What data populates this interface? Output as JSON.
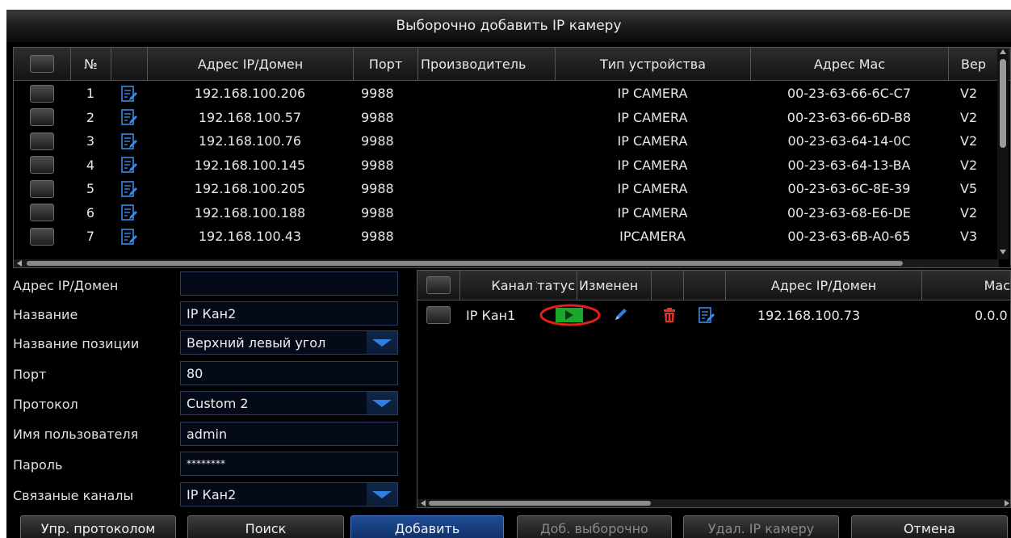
{
  "window": {
    "title": "Выборочно добавить IP камеру"
  },
  "colors": {
    "accent": "#2e7fe0",
    "primary_button": "#1f4d96",
    "status_ok": "#1aa82a",
    "delete_red": "#e0322a",
    "highlight_circle": "#e0201a"
  },
  "camera_table": {
    "headers": {
      "no": "№",
      "ip": "Адрес IP/Домен",
      "port": "Порт",
      "manufacturer": "Производитель",
      "device_type": "Тип устройства",
      "mac": "Адрес Mac",
      "version": "Вер"
    },
    "rows": [
      {
        "no": "1",
        "ip": "192.168.100.206",
        "port": "9988",
        "manufacturer": "",
        "device_type": "IP CAMERA",
        "mac": "00-23-63-66-6C-C7",
        "version": "V2"
      },
      {
        "no": "2",
        "ip": "192.168.100.57",
        "port": "9988",
        "manufacturer": "",
        "device_type": "IP CAMERA",
        "mac": "00-23-63-66-6D-B8",
        "version": "V2"
      },
      {
        "no": "3",
        "ip": "192.168.100.76",
        "port": "9988",
        "manufacturer": "",
        "device_type": "IP CAMERA",
        "mac": "00-23-63-64-14-0C",
        "version": "V2"
      },
      {
        "no": "4",
        "ip": "192.168.100.145",
        "port": "9988",
        "manufacturer": "",
        "device_type": "IP CAMERA",
        "mac": "00-23-63-64-13-BA",
        "version": "V2"
      },
      {
        "no": "5",
        "ip": "192.168.100.205",
        "port": "9988",
        "manufacturer": "",
        "device_type": "IP CAMERA",
        "mac": "00-23-63-6C-8E-39",
        "version": "V5"
      },
      {
        "no": "6",
        "ip": "192.168.100.188",
        "port": "9988",
        "manufacturer": "",
        "device_type": "IP CAMERA",
        "mac": "00-23-63-68-E6-DE",
        "version": "V2"
      },
      {
        "no": "7",
        "ip": "192.168.100.43",
        "port": "9988",
        "manufacturer": "",
        "device_type": "IPCAMERA",
        "mac": "00-23-63-6B-A0-65",
        "version": "V3"
      }
    ]
  },
  "form": {
    "ip_label": "Адрес IP/Домен",
    "ip_value": "",
    "name_label": "Название",
    "name_value": "IP Кан2",
    "position_label": "Название позиции",
    "position_value": "Верхний левый угол",
    "port_label": "Порт",
    "port_value": "80",
    "protocol_label": "Протокол",
    "protocol_value": "Custom 2",
    "user_label": "Имя пользователя",
    "user_value": "admin",
    "password_label": "Пароль",
    "password_value": "********",
    "linked_label": "Связаные каналы",
    "linked_value": "IP Кан2"
  },
  "added_table": {
    "headers": {
      "channel": "Канал",
      "status": "Статус",
      "change": "Изменен",
      "ip": "Адрес IP/Домен",
      "mac": "Mac"
    },
    "rows": [
      {
        "channel": "IP Кан1",
        "ip": "192.168.100.73",
        "mac": "0.0.0"
      }
    ]
  },
  "buttons": {
    "protocol_mgmt": "Упр. протоколом",
    "search": "Поиск",
    "add": "Добавить",
    "add_selected": "Доб. выборочно",
    "delete_ip_camera": "Удал. IP камеру",
    "cancel": "Отмена"
  }
}
